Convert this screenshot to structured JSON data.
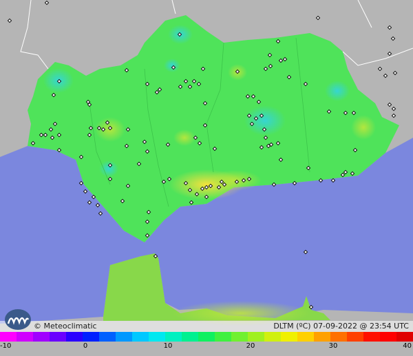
{
  "map": {
    "colors": {
      "land_warm": "#4fe35a",
      "land_grey": "#b3b3b3",
      "sea": "#7a86dd",
      "coast_yellow": "#c8e04a",
      "station": "#111111"
    }
  },
  "footer": {
    "credit": "© Meteoclimatic",
    "variable": "DLTM (ºC)",
    "datetime": "07-09-2022 @ 23:54 UTC"
  },
  "legend": {
    "min": -10,
    "max": 40,
    "tick_labels": [
      "-10",
      "0",
      "10",
      "20",
      "30",
      "40"
    ]
  }
}
